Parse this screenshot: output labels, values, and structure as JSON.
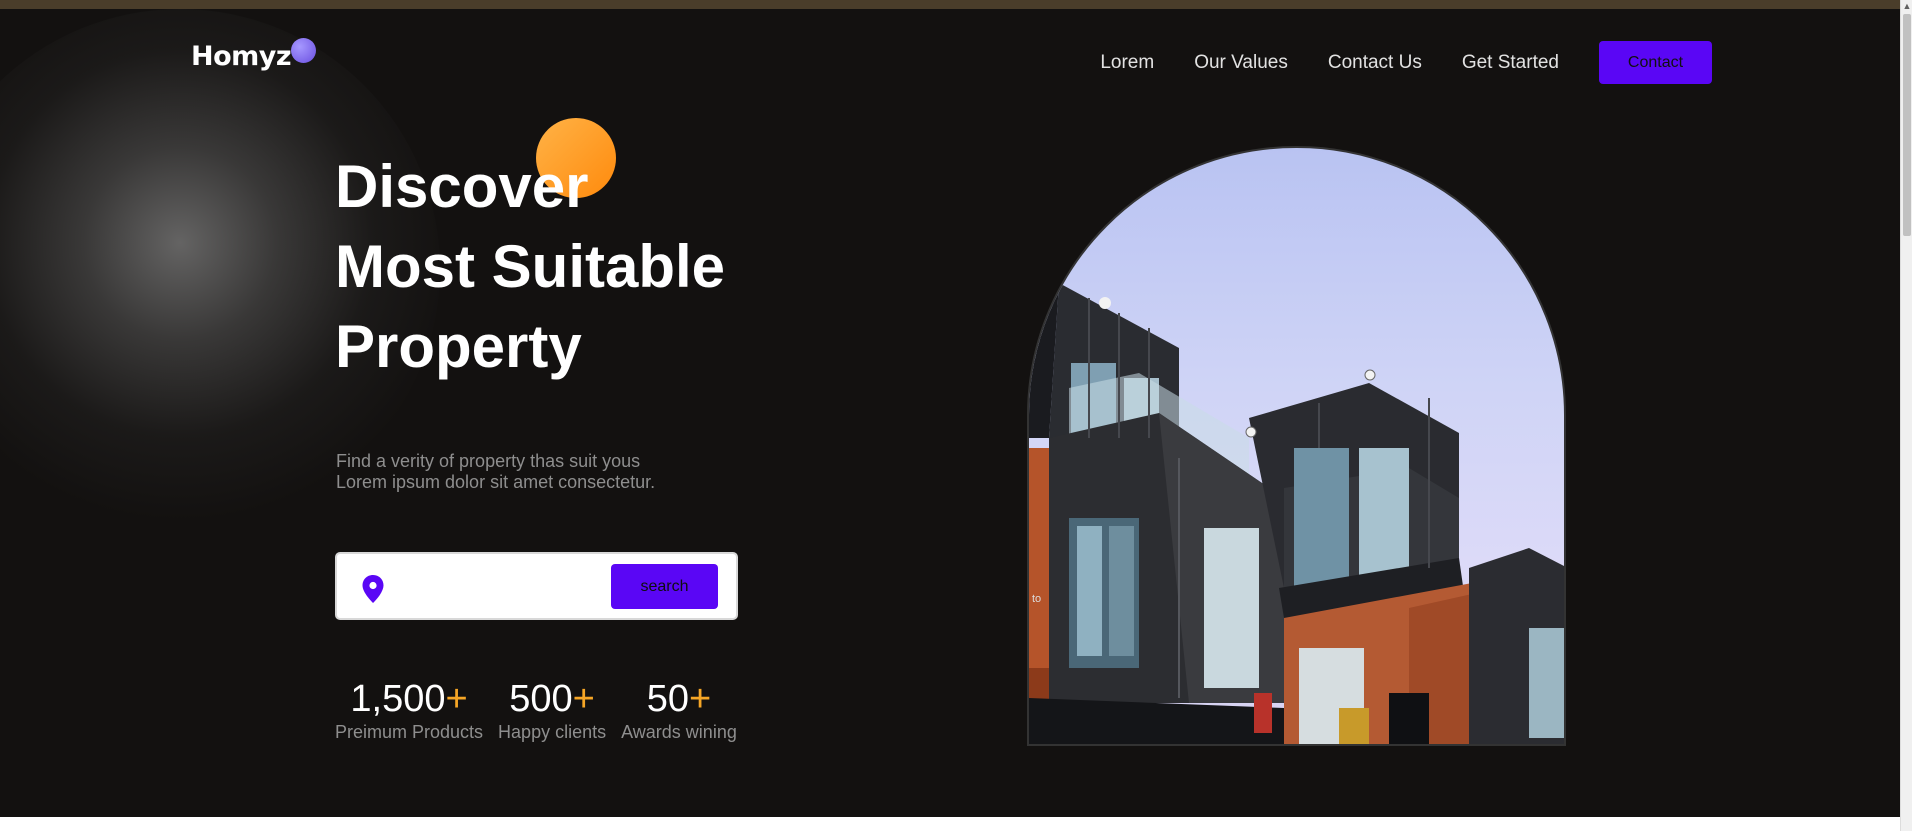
{
  "brand": {
    "name": "Homyz"
  },
  "nav": {
    "items": [
      "Lorem",
      "Our Values",
      "Contact Us",
      "Get Started"
    ],
    "contact_label": "Contact"
  },
  "hero": {
    "headline": [
      "Discover",
      "Most Suitable",
      "Property"
    ],
    "subtext": [
      "Find a verity of property thas suit yous",
      "Lorem ipsum dolor sit amet consectetur."
    ],
    "search": {
      "placeholder": "",
      "button_label": "search",
      "icon": "location-pin-icon"
    },
    "stats": [
      {
        "value": "1,500",
        "suffix": "+",
        "label": "Preimum Products"
      },
      {
        "value": "500",
        "suffix": "+",
        "label": "Happy clients"
      },
      {
        "value": "50",
        "suffix": "+",
        "label": "Awards wining"
      }
    ],
    "image_text": "to"
  },
  "colors": {
    "accent": "#5a06f5",
    "orange": "#f6a626",
    "background": "#131110",
    "logo_dot": "#8b78f5"
  }
}
